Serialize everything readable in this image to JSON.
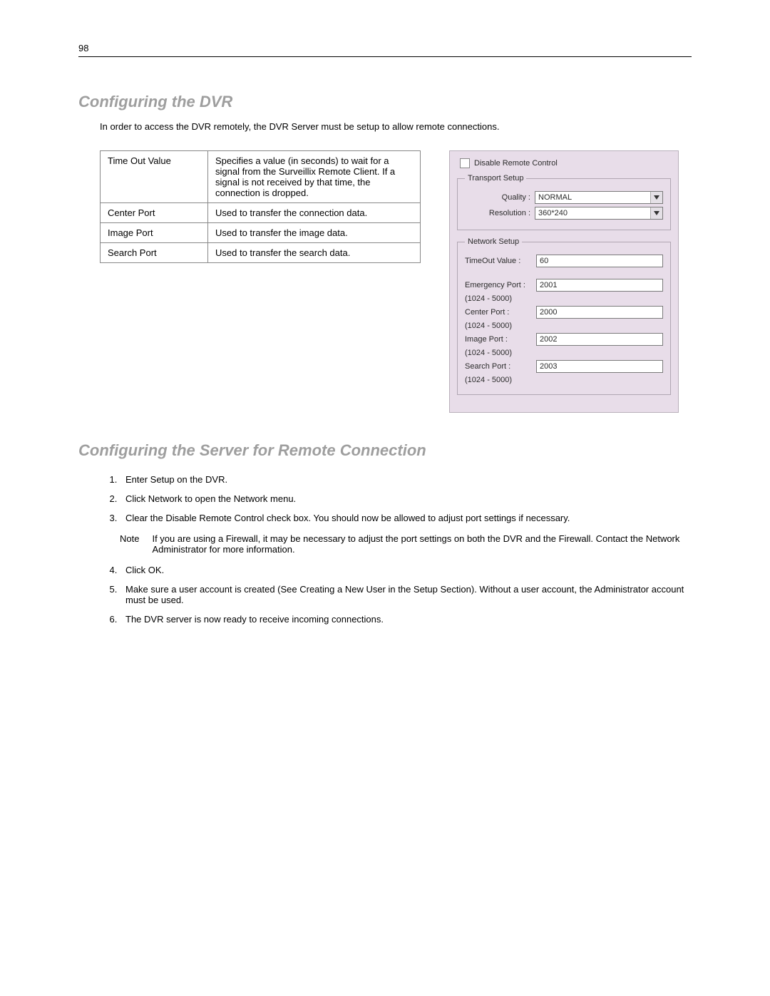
{
  "page_number": "98",
  "section1": {
    "title": "Configuring the DVR",
    "intro": "In order to access the DVR remotely, the DVR Server must be setup to allow remote connections.",
    "table": [
      {
        "term": "Time Out Value",
        "desc": "Specifies a value (in seconds) to wait for a signal from the Surveillix Remote Client.  If a signal is not received by that time, the connection is dropped."
      },
      {
        "term": "Center Port",
        "desc": "Used to transfer the connection data."
      },
      {
        "term": "Image Port",
        "desc": "Used to transfer the image data."
      },
      {
        "term": "Search Port",
        "desc": "Used to transfer the search data."
      }
    ]
  },
  "dialog": {
    "disable_label": "Disable Remote Control",
    "transport_legend": "Transport Setup",
    "quality_label": "Quality :",
    "quality_value": "NORMAL",
    "resolution_label": "Resolution :",
    "resolution_value": "360*240",
    "network_legend": "Network Setup",
    "timeout_label": "TimeOut Value :",
    "timeout_value": "60",
    "emergency_label": "Emergency Port :",
    "emergency_value": "2001",
    "center_label": "Center Port :",
    "center_value": "2000",
    "image_label": "Image Port :",
    "image_value": "2002",
    "search_label": "Search Port :",
    "search_value": "2003",
    "range_hint": "(1024 - 5000)"
  },
  "section2": {
    "title": "Configuring the Server for Remote Connection",
    "steps": {
      "s1": "Enter Setup on the DVR.",
      "s2a": "Click ",
      "s2b": "Network",
      "s2c": " to open the Network menu.",
      "s3a": "Clear the ",
      "s3b": "Disable Remote Control",
      "s3c": " check box. You should now be allowed to adjust port settings if necessary.",
      "note_label": "Note",
      "note_text": "If you are using a Firewall, it may be necessary to adjust the port settings on both the DVR and the Firewall.  Contact the Network Administrator for more information.",
      "s4a": "Click ",
      "s4b": "OK",
      "s4c": ".",
      "s5": "Make sure a user account is created (See Creating a New User in the Setup Section).  Without a user account, the Administrator account must be used.",
      "s6": "The DVR server is now ready to receive incoming connections."
    }
  }
}
